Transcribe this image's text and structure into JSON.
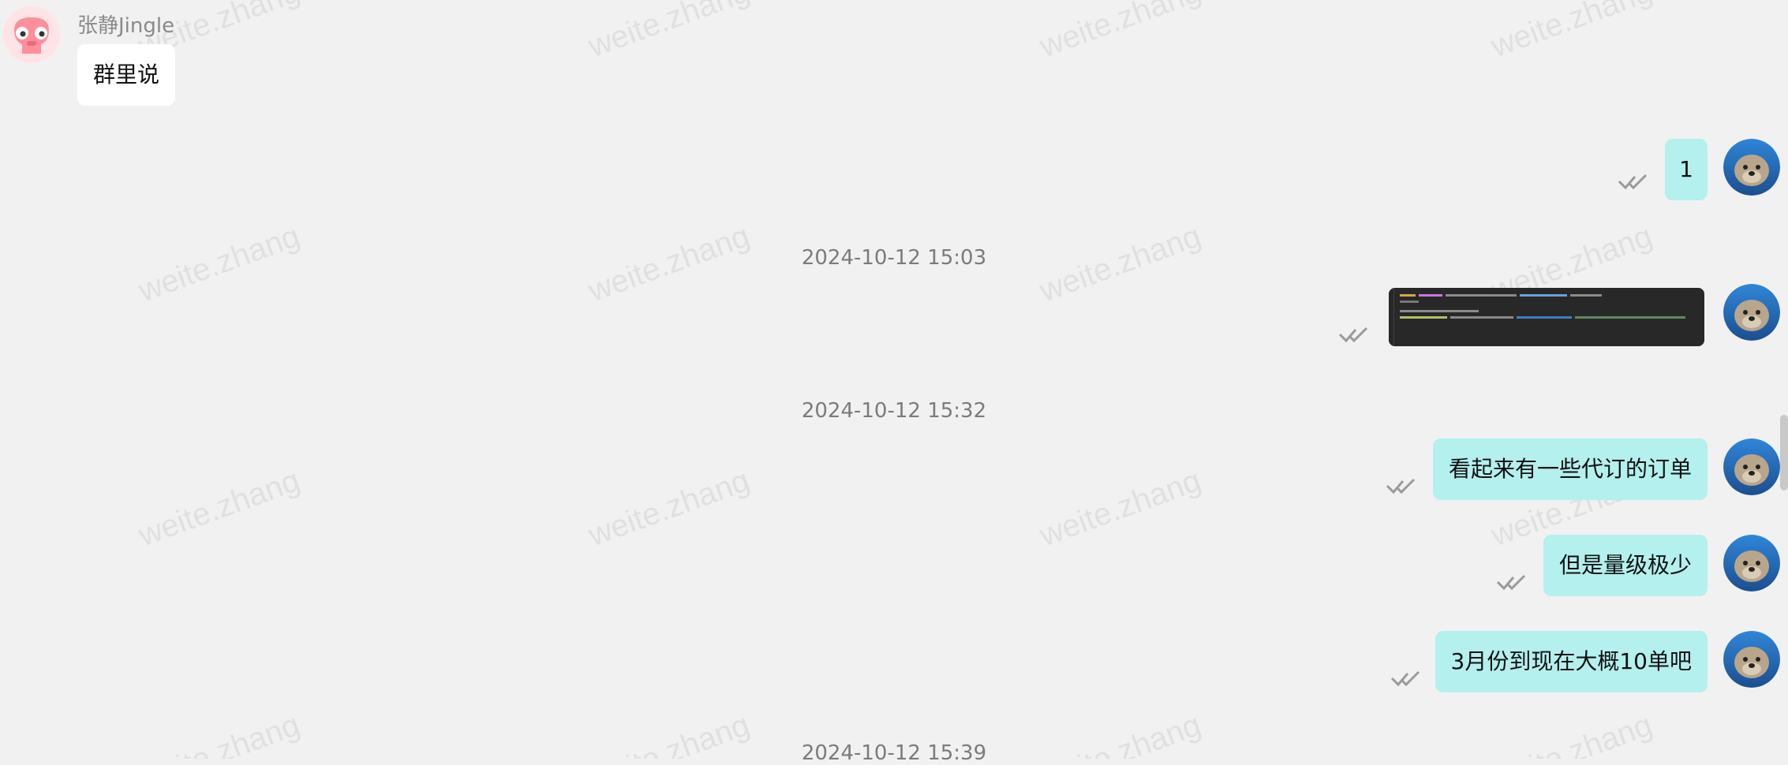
{
  "watermark_text": "weite.zhang",
  "incoming": {
    "sender_name": "张静Jingle",
    "avatar_icon": "pink-cartoon-avatar-icon",
    "message": "群里说"
  },
  "outgoing_avatar_icon": "otter-avatar-icon",
  "messages": {
    "msg1": "1",
    "msg2": "看起来有一些代订的订单",
    "msg3": "但是量级极少",
    "msg4": "3月份到现在大概10单吧"
  },
  "timestamps": {
    "t1": "2024-10-12 15:03",
    "t2": "2024-10-12 15:32",
    "t3": "2024-10-12 15:39"
  },
  "image_message": {
    "kind": "code-editor-screenshot-thumbnail"
  },
  "colors": {
    "background": "#f1f1f1",
    "outgoing_bubble": "#b3f0ee",
    "incoming_bubble": "#ffffff",
    "read_check": "#9a9a9a"
  }
}
